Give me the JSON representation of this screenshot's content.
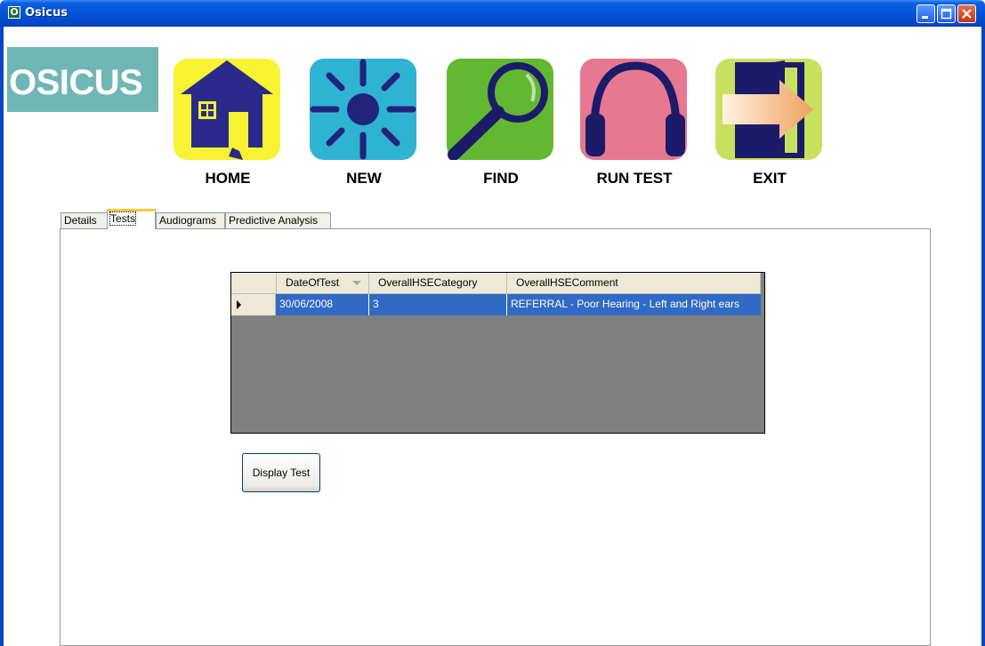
{
  "window": {
    "title": "Osicus",
    "icon_letter": "O"
  },
  "logo": {
    "text": "OSICUS",
    "color": "#6fb7b5"
  },
  "toolbar": {
    "home": {
      "label": "HOME",
      "icon": "house-icon",
      "color": "#f7f232"
    },
    "new": {
      "label": "NEW",
      "icon": "sun-icon",
      "color": "#2fb3d3"
    },
    "find": {
      "label": "FIND",
      "icon": "magnifier-icon",
      "color": "#62b830"
    },
    "run_test": {
      "label": "RUN TEST",
      "icon": "headphones-icon",
      "color": "#e67891"
    },
    "exit": {
      "label": "EXIT",
      "icon": "door-exit-icon",
      "color": "#c8e060"
    }
  },
  "tabs": [
    {
      "label": "Details",
      "active": false
    },
    {
      "label": "Tests",
      "active": true
    },
    {
      "label": "Audiograms",
      "active": false
    },
    {
      "label": "Predictive Analysis",
      "active": false
    }
  ],
  "grid": {
    "columns": [
      "DateOfTest",
      "OverallHSECategory",
      "OverallHSEComment"
    ],
    "sorted_column": "DateOfTest",
    "rows": [
      {
        "selected": true,
        "cells": [
          "30/06/2008",
          "3",
          "REFERRAL - Poor Hearing - Left and Right ears"
        ]
      }
    ]
  },
  "buttons": {
    "display_test": "Display Test"
  },
  "colors": {
    "selection": "#316ac5",
    "titlebar": "#0553d6",
    "tab_highlight": "#ffc83c"
  }
}
